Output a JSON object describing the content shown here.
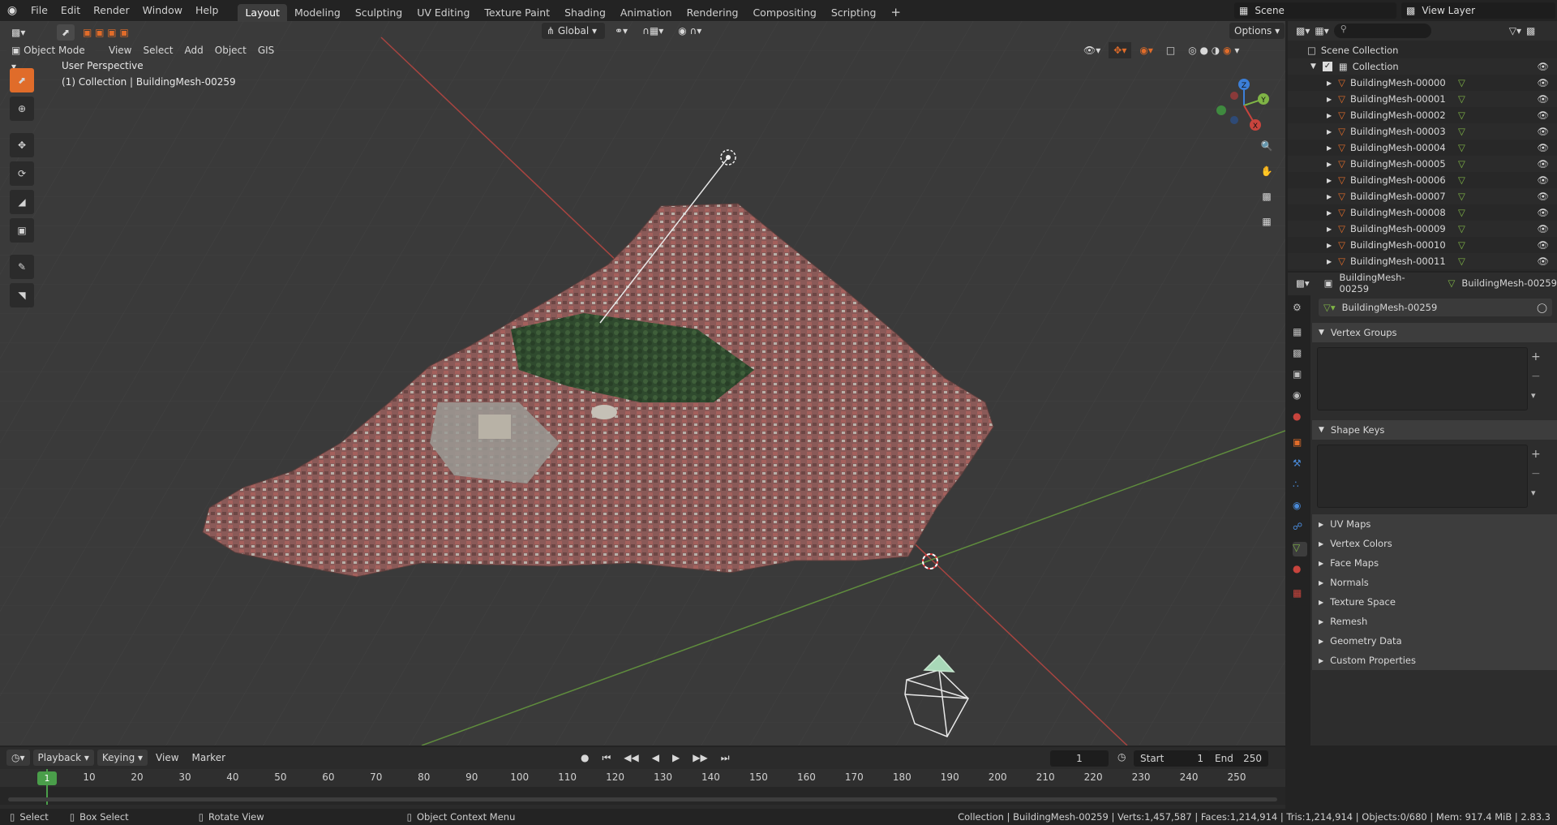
{
  "topbar": {
    "menus": [
      "File",
      "Edit",
      "Render",
      "Window",
      "Help"
    ],
    "workspaces": [
      "Layout",
      "Modeling",
      "Sculpting",
      "UV Editing",
      "Texture Paint",
      "Shading",
      "Animation",
      "Rendering",
      "Compositing",
      "Scripting"
    ],
    "active_workspace": "Layout",
    "scene": "Scene",
    "view_layer": "View Layer"
  },
  "viewport": {
    "mode": "Object Mode",
    "menus": [
      "View",
      "Select",
      "Add",
      "Object",
      "GIS"
    ],
    "orientation": "Global",
    "options": "Options",
    "perspective_label": "User Perspective",
    "collection_label": "(1) Collection | BuildingMesh-00259",
    "gizmo_axes": {
      "x": "X",
      "y": "Y",
      "z": "Z"
    }
  },
  "outliner": {
    "root": "Scene Collection",
    "collection": "Collection",
    "items": [
      "BuildingMesh-00000",
      "BuildingMesh-00001",
      "BuildingMesh-00002",
      "BuildingMesh-00003",
      "BuildingMesh-00004",
      "BuildingMesh-00005",
      "BuildingMesh-00006",
      "BuildingMesh-00007",
      "BuildingMesh-00008",
      "BuildingMesh-00009",
      "BuildingMesh-00010",
      "BuildingMesh-00011"
    ]
  },
  "properties": {
    "breadcrumb_object": "BuildingMesh-00259",
    "breadcrumb_data": "BuildingMesh-00259",
    "mesh_name": "BuildingMesh-00259",
    "panels_open": [
      "Vertex Groups",
      "Shape Keys"
    ],
    "panels_collapsed": [
      "UV Maps",
      "Vertex Colors",
      "Face Maps",
      "Normals",
      "Texture Space",
      "Remesh",
      "Geometry Data",
      "Custom Properties"
    ]
  },
  "timeline": {
    "menus": [
      "Playback",
      "Keying",
      "View",
      "Marker"
    ],
    "current_frame": "1",
    "start_label": "Start",
    "start": "1",
    "end_label": "End",
    "end": "250",
    "ticks": [
      "1",
      "10",
      "20",
      "30",
      "40",
      "50",
      "60",
      "70",
      "80",
      "90",
      "100",
      "110",
      "120",
      "130",
      "140",
      "150",
      "160",
      "170",
      "180",
      "190",
      "200",
      "210",
      "220",
      "230",
      "240",
      "250"
    ]
  },
  "statusbar": {
    "select": "Select",
    "box_select": "Box Select",
    "rotate_view": "Rotate View",
    "context_menu": "Object Context Menu",
    "stats": "Collection | BuildingMesh-00259 | Verts:1,457,587 | Faces:1,214,914 | Tris:1,214,914 | Objects:0/680 | Mem: 917.4 MiB | 2.83.3"
  },
  "colors": {
    "accent": "#e06c2a",
    "selection": "#4772b3",
    "x_axis": "#c8443d",
    "y_axis": "#7fb446",
    "z_axis": "#3c7fd8"
  }
}
